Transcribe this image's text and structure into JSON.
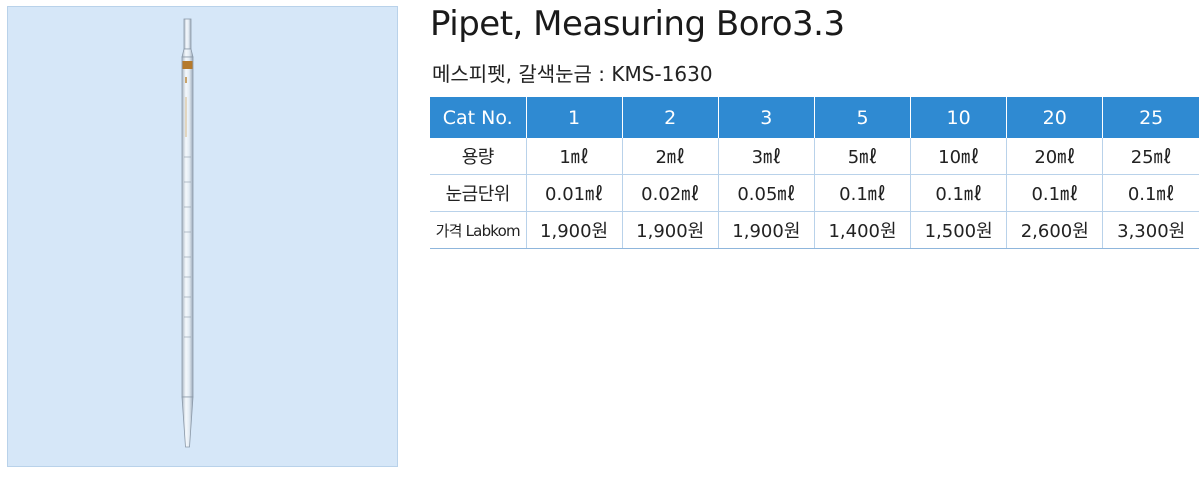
{
  "product": {
    "title": "Pipet, Measuring Boro3.3",
    "subtitle": "메스피펫, 갈색눈금 : KMS-1630",
    "image_label": "pipet-image"
  },
  "table": {
    "headers": [
      "Cat No.",
      "1",
      "2",
      "3",
      "5",
      "10",
      "20",
      "25"
    ],
    "rows": [
      [
        "용량",
        "1㎖",
        "2㎖",
        "3㎖",
        "5㎖",
        "10㎖",
        "20㎖",
        "25㎖"
      ],
      [
        "눈금단위",
        "0.01㎖",
        "0.02㎖",
        "0.05㎖",
        "0.1㎖",
        "0.1㎖",
        "0.1㎖",
        "0.1㎖"
      ],
      [
        "가격 Labkom",
        "1,900원",
        "1,900원",
        "1,900원",
        "1,400원",
        "1,500원",
        "2,600원",
        "3,300원"
      ]
    ]
  },
  "colors": {
    "header_bg": "#2f8ad2",
    "panel_bg": "#d6e7f8",
    "graduation_brown": "#b57a2c"
  }
}
